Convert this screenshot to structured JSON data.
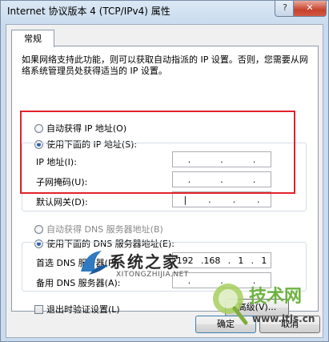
{
  "window": {
    "title": "Internet 协议版本 4 (TCP/IPv4) 属性",
    "help_label": "?",
    "close_label": "✕"
  },
  "tab": {
    "label": "常规"
  },
  "description": "如果网络支持此功能，则可以获取自动指派的 IP 设置。否则，您需要从网络系统管理员处获得适当的 IP 设置。",
  "ip": {
    "auto_label": "自动获得 IP 地址(O)",
    "manual_label": "使用下面的 IP 地址(S):",
    "address_label": "IP 地址(I):",
    "subnet_label": "子网掩码(U):",
    "gateway_label": "默认网关(D):",
    "address_value": [
      ".",
      ".",
      "."
    ],
    "subnet_value": [
      ".",
      ".",
      "."
    ],
    "gateway_value": [
      "|",
      ".",
      ".",
      "."
    ],
    "mode": "manual"
  },
  "dns": {
    "auto_label": "自动获得 DNS 服务器地址(B)",
    "manual_label": "使用下面的 DNS 服务器地址(E):",
    "preferred_label": "首选 DNS 服务器(P):",
    "alternate_label": "备用 DNS 服务器(A):",
    "preferred_value": [
      "192",
      ".168",
      ".",
      "1",
      ".",
      "1"
    ],
    "alternate_value": [
      ".",
      ".",
      "."
    ]
  },
  "validate_label": "退出时验证设置(L)",
  "advanced_label": "高级(V)...",
  "ok_label": "确定",
  "cancel_label": "取消",
  "watermark1": {
    "main": "系统之家",
    "sub": "XITONGZHIJIA.NET"
  },
  "watermark2": {
    "main": "技术网",
    "url": "www.itjs.cn"
  },
  "colors": {
    "highlight": "#e2232a",
    "selected_radio": "#2b5fad"
  }
}
